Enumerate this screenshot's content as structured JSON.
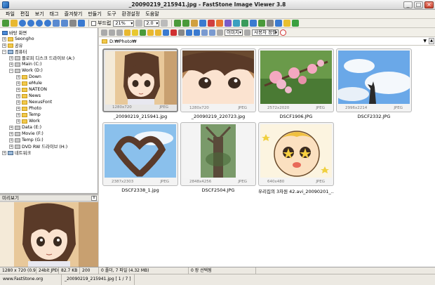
{
  "window": {
    "title": "_20090219_215941.jpg - FastStone Image Viewer 3.8",
    "minimize": "_",
    "maximize": "□",
    "close": "×"
  },
  "menu": [
    "파일",
    "편집",
    "보기",
    "태그",
    "즐겨찾기",
    "만들기",
    "도구",
    "환경설정",
    "도움말"
  ],
  "toolbar": {
    "slideshow_label": "부드럽",
    "zoom_value": "21%",
    "ratio_value": "2.0"
  },
  "content_toolbar": {
    "sort_value": "이미지",
    "view_value": "사용자 정렬"
  },
  "address": {
    "path": "D:₩Photo₩"
  },
  "tree": [
    {
      "label": "바탕 화면",
      "icon": "desktop-icon"
    },
    {
      "label": "Seongho",
      "icon": "folder-icon"
    },
    {
      "label": "공유",
      "icon": "folder-icon"
    },
    {
      "label": "컴퓨터",
      "icon": "computer-icon"
    },
    {
      "label": "플로피 디스크 드라이브 (A:)",
      "icon": "drive-icon"
    },
    {
      "label": "Main (C:)",
      "icon": "drive-icon"
    },
    {
      "label": "Work (D:)",
      "icon": "drive-icon"
    },
    {
      "label": "Down",
      "icon": "folder-icon"
    },
    {
      "label": "eMule",
      "icon": "folder-icon"
    },
    {
      "label": "NATEON",
      "icon": "folder-icon"
    },
    {
      "label": "News",
      "icon": "folder-icon"
    },
    {
      "label": "NexusFont",
      "icon": "folder-icon"
    },
    {
      "label": "Photo",
      "icon": "folder-icon"
    },
    {
      "label": "Temp",
      "icon": "folder-icon"
    },
    {
      "label": "Work",
      "icon": "folder-icon"
    },
    {
      "label": "Data (E:)",
      "icon": "drive-icon"
    },
    {
      "label": "Movie (F:)",
      "icon": "drive-icon"
    },
    {
      "label": "Temp (G:)",
      "icon": "drive-icon"
    },
    {
      "label": "DVD RW 드라이브 (H:)",
      "icon": "drive-icon"
    },
    {
      "label": "네트워크",
      "icon": "computer-icon"
    }
  ],
  "preview": {
    "title": "미리보기",
    "pin": "⊼"
  },
  "thumbnails": [
    {
      "name": "_20090219_215941.jpg",
      "size": "1280x720",
      "type": "JPEG",
      "selected": true
    },
    {
      "name": "_20090219_220723.jpg",
      "size": "1280x720",
      "type": "JPEG",
      "selected": false
    },
    {
      "name": "DSCF1906.JPG",
      "size": "2572x2020",
      "type": "JPEG",
      "selected": false
    },
    {
      "name": "DSCF2332.JPG",
      "size": "2996x2214",
      "type": "JPEG",
      "selected": false
    },
    {
      "name": "DSCF2338_1.jpg",
      "size": "2387x2303",
      "type": "JPEG",
      "selected": false
    },
    {
      "name": "DSCF2504.JPG",
      "size": "2848x4256",
      "type": "JPEG",
      "selected": false
    },
    {
      "name": "우리집의 3차원 42.avi_20090201_...",
      "size": "640x480",
      "type": "JPEG",
      "selected": false
    }
  ],
  "status": {
    "info": "1280 x 720 (0.92MP)",
    "depth": "24bit JPEG",
    "filesize": "82.7 KB",
    "year": "200",
    "folders": "0 폴더, 7 파일 (4.32 MB)",
    "selected": "0 장 선택됨",
    "website": "www.FastStone.org",
    "current": "_20090219_215941.jpg [ 1 / 7 ]"
  }
}
